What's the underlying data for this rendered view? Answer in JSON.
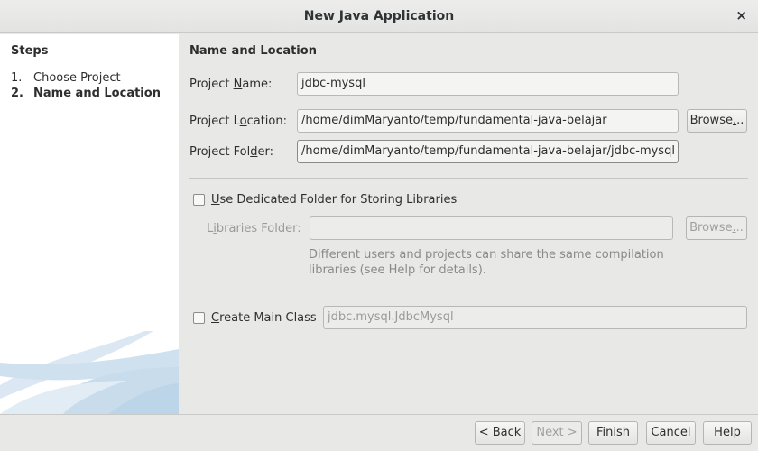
{
  "window": {
    "title": "New Java Application",
    "close_glyph": "×"
  },
  "steps": {
    "header": "Steps",
    "items": [
      {
        "num": "1.",
        "label": "Choose Project"
      },
      {
        "num": "2.",
        "label": "Name and Location"
      }
    ]
  },
  "section_title": "Name and Location",
  "project_name": {
    "label_pre": "Project ",
    "label_mn": "N",
    "label_post": "ame:",
    "value": "jdbc-mysql"
  },
  "project_location": {
    "label_pre": "Project L",
    "label_mn": "o",
    "label_post": "cation:",
    "value": "/home/dimMaryanto/temp/fundamental-java-belajar",
    "browse_pre": "Browse",
    "browse_mn": ".",
    "browse_post": ".."
  },
  "project_folder": {
    "label_pre": "Project Fol",
    "label_mn": "d",
    "label_post": "er:",
    "value": "/home/dimMaryanto/temp/fundamental-java-belajar/jdbc-mysql"
  },
  "dedicated": {
    "label_mn": "U",
    "label_post": "se Dedicated Folder for Storing Libraries",
    "checked": false
  },
  "libraries": {
    "label_pre": "L",
    "label_mn": "i",
    "label_post": "braries Folder:",
    "value": "",
    "browse_pre": "Browse",
    "browse_mn": ".",
    "browse_post": "..",
    "hint_line1": "Different users and projects can share the same compilation",
    "hint_line2": "libraries (see Help for details)."
  },
  "main_class": {
    "label_mn": "C",
    "label_post": "reate Main Class",
    "checked": false,
    "value": "jdbc.mysql.JdbcMysql"
  },
  "footer": {
    "back_pre": "< ",
    "back_mn": "B",
    "back_post": "ack",
    "next_label": "Next >",
    "finish_mn": "F",
    "finish_post": "inish",
    "cancel_label": "Cancel",
    "help_mn": "H",
    "help_post": "elp"
  }
}
